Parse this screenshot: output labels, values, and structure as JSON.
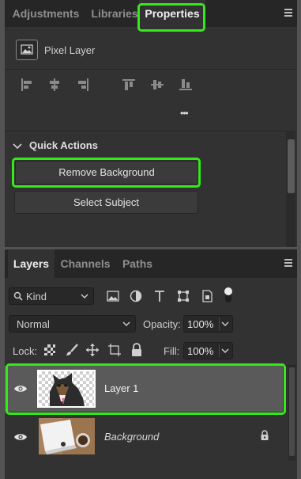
{
  "properties_panel": {
    "tabs": [
      {
        "label": "Adjustments",
        "active": false
      },
      {
        "label": "Libraries",
        "active": false
      },
      {
        "label": "Properties",
        "active": true
      }
    ],
    "layer_kind_label": "Pixel Layer",
    "align_icons": [
      "align-left-edges-icon",
      "align-horizontal-centers-icon",
      "align-right-edges-icon",
      "align-top-edges-icon",
      "align-vertical-centers-icon",
      "align-bottom-edges-icon"
    ],
    "more_label": "•••",
    "quick_actions": {
      "title": "Quick Actions",
      "buttons": [
        "Remove Background",
        "Select Subject"
      ]
    }
  },
  "layers_panel": {
    "tabs": [
      {
        "label": "Layers",
        "active": true
      },
      {
        "label": "Channels",
        "active": false
      },
      {
        "label": "Paths",
        "active": false
      }
    ],
    "filter": {
      "kind_label": "Kind"
    },
    "blend_mode": "Normal",
    "opacity": {
      "label": "Opacity:",
      "value": "100%"
    },
    "lock_label": "Lock:",
    "fill": {
      "label": "Fill:",
      "value": "100%"
    },
    "layers": [
      {
        "name": "Layer 1",
        "visible": true,
        "selected": true,
        "locked": false
      },
      {
        "name": "Background",
        "visible": true,
        "selected": false,
        "locked": true
      }
    ]
  },
  "colors": {
    "highlight": "#35e81a",
    "panel_bg": "#323232",
    "selected_layer": "#5a5a5a"
  }
}
